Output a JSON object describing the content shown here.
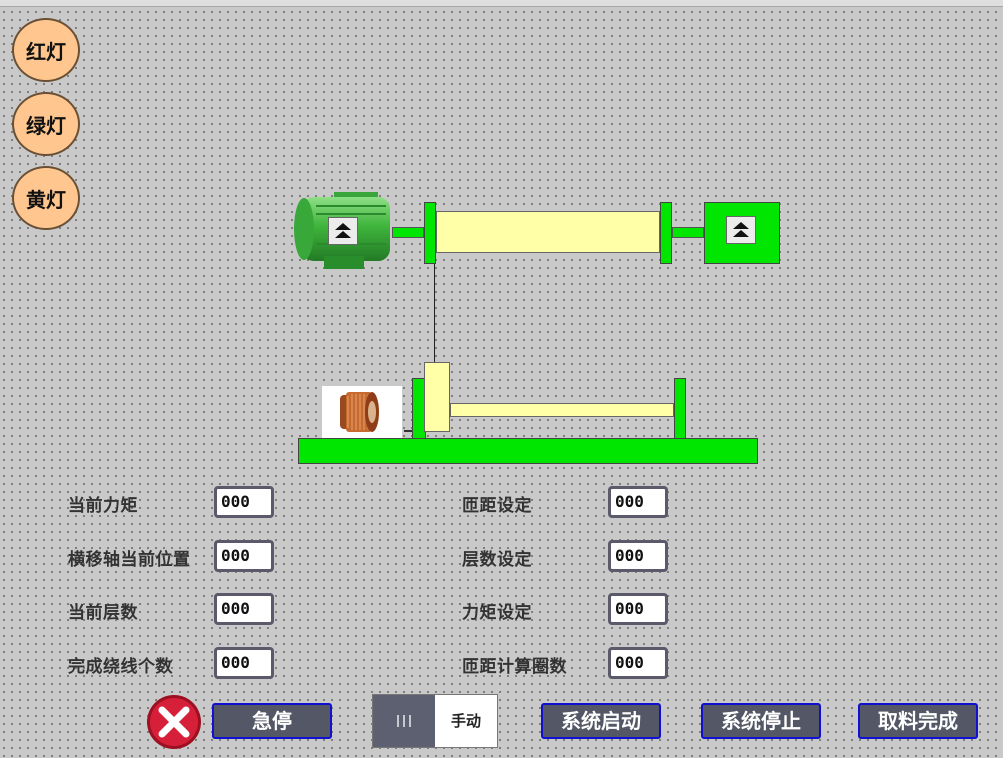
{
  "lamps": {
    "red": "红灯",
    "green": "绿灯",
    "yellow": "黄灯"
  },
  "readouts": [
    {
      "label": "当前力矩",
      "value": "000"
    },
    {
      "label": "横移轴当前位置",
      "value": "000"
    },
    {
      "label": "当前层数",
      "value": "000"
    },
    {
      "label": "完成绕线个数",
      "value": "000"
    }
  ],
  "settings": [
    {
      "label": "匝距设定",
      "value": "000"
    },
    {
      "label": "层数设定",
      "value": "000"
    },
    {
      "label": "力矩设定",
      "value": "000"
    },
    {
      "label": "匝距计算圈数",
      "value": "000"
    }
  ],
  "controls": {
    "estop": "急停",
    "mode": "手动",
    "start": "系统启动",
    "stop": "系统停止",
    "finish": "取料完成"
  },
  "colors": {
    "machine_green": "#00e600",
    "roller_yellow": "#ffffa8",
    "lamp_off": "#ffc78f",
    "button_border": "#1010d0"
  },
  "icons": {
    "motor": "motor-icon",
    "encoder": "encoder-icon",
    "spool": "wire-spool-icon",
    "estop": "close-icon"
  }
}
